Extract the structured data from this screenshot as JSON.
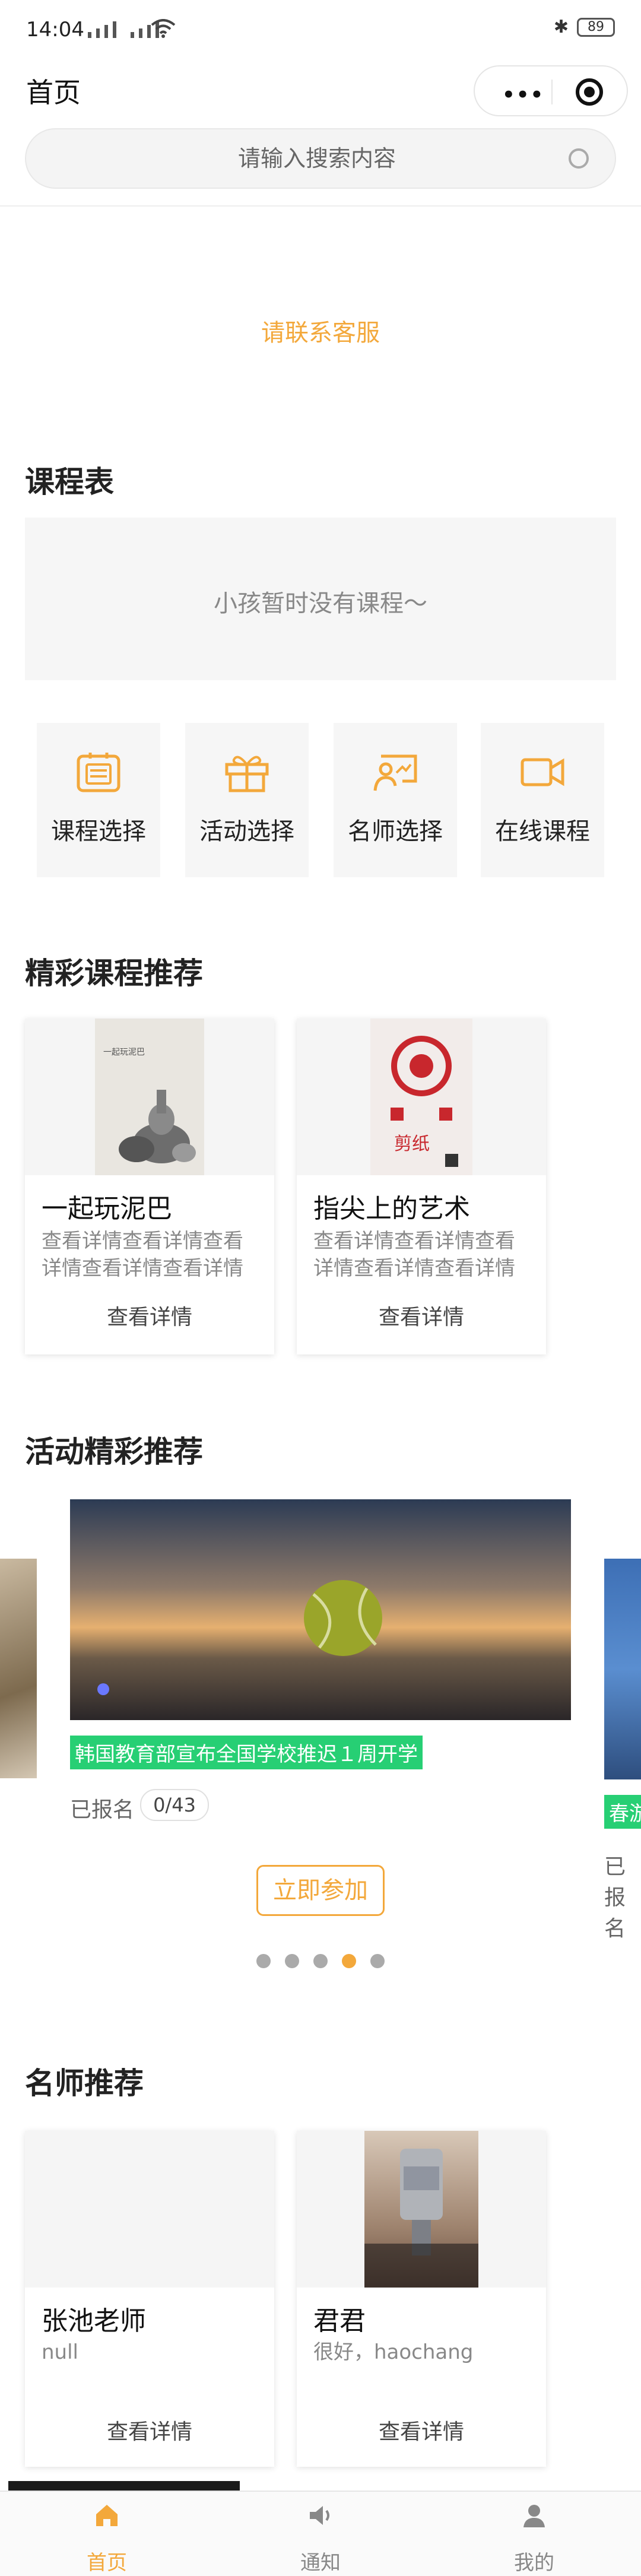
{
  "status_bar": {
    "time": "14:04",
    "battery": "89"
  },
  "nav": {
    "title": "首页"
  },
  "search": {
    "placeholder": "请输入搜索内容"
  },
  "contact_text": "请联系客服",
  "schedule": {
    "title": "课程表",
    "empty_text": "小孩暂时没有课程～"
  },
  "quick_links": [
    {
      "label": "课程选择",
      "icon": "calendar-icon"
    },
    {
      "label": "活动选择",
      "icon": "gift-icon"
    },
    {
      "label": "名师选择",
      "icon": "teacher-board-icon"
    },
    {
      "label": "在线课程",
      "icon": "video-camera-icon"
    }
  ],
  "courses": {
    "title": "精彩课程推荐",
    "items": [
      {
        "name": "一起玩泥巴",
        "poster_text": "一起玩泥巴",
        "desc": "查看详情查看详情查看详情查看详情查看详情查看详情",
        "action": "查看详情"
      },
      {
        "name": "指尖上的艺术",
        "poster_text": "剪纸",
        "desc": "查看详情查看详情查看详情查看详情查看详情查看详情",
        "action": "查看详情"
      }
    ]
  },
  "activities": {
    "title": "活动精彩推荐",
    "current": {
      "tag": "韩国教育部宣布全国学校推迟１周开学",
      "enrolled_label": "已报名",
      "count": "0/43"
    },
    "next": {
      "tag": "春游",
      "enrolled_label": "已报名"
    },
    "join_label": "立即参加",
    "dots": 5,
    "active_dot": 4
  },
  "teachers": {
    "title": "名师推荐",
    "items": [
      {
        "name": "张池老师",
        "desc": "null",
        "action": "查看详情"
      },
      {
        "name": "君君",
        "desc": "很好，haochang",
        "action": "查看详情"
      }
    ]
  },
  "tab_bar": [
    {
      "label": "首页",
      "icon": "home-icon",
      "active": true
    },
    {
      "label": "通知",
      "icon": "speaker-icon",
      "active": false
    },
    {
      "label": "我的",
      "icon": "user-icon",
      "active": false
    }
  ],
  "colors": {
    "accent": "#f3a83b",
    "tag_green": "#27cf74"
  }
}
